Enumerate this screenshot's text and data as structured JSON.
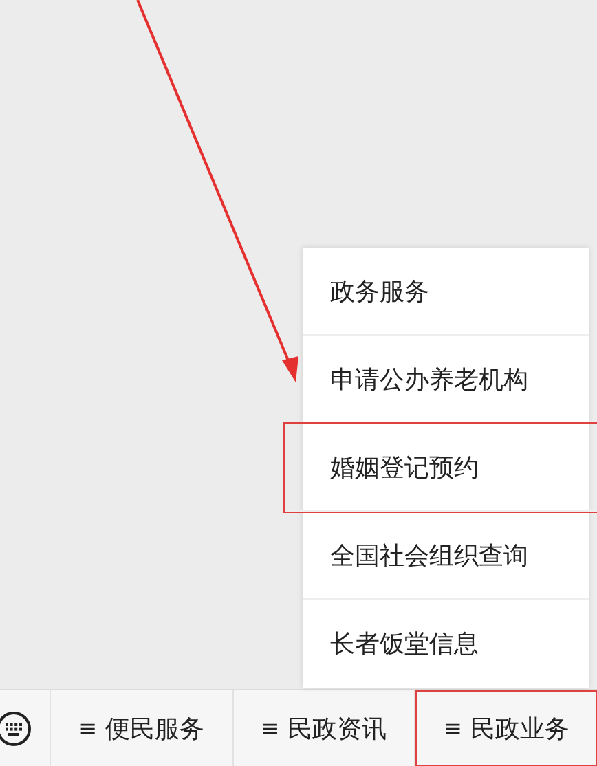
{
  "menu": {
    "items": [
      {
        "label": "政务服务",
        "highlighted": false
      },
      {
        "label": "申请公办养老机构",
        "highlighted": false
      },
      {
        "label": "婚姻登记预约",
        "highlighted": true
      },
      {
        "label": "全国社会组织查询",
        "highlighted": false
      },
      {
        "label": "长者饭堂信息",
        "highlighted": false
      }
    ]
  },
  "bottom_bar": {
    "tabs": [
      {
        "icon": "≡",
        "label": "便民服务",
        "highlighted": false
      },
      {
        "icon": "≡",
        "label": "民政资讯",
        "highlighted": false
      },
      {
        "icon": "≡",
        "label": "民政业务",
        "highlighted": true
      }
    ]
  }
}
